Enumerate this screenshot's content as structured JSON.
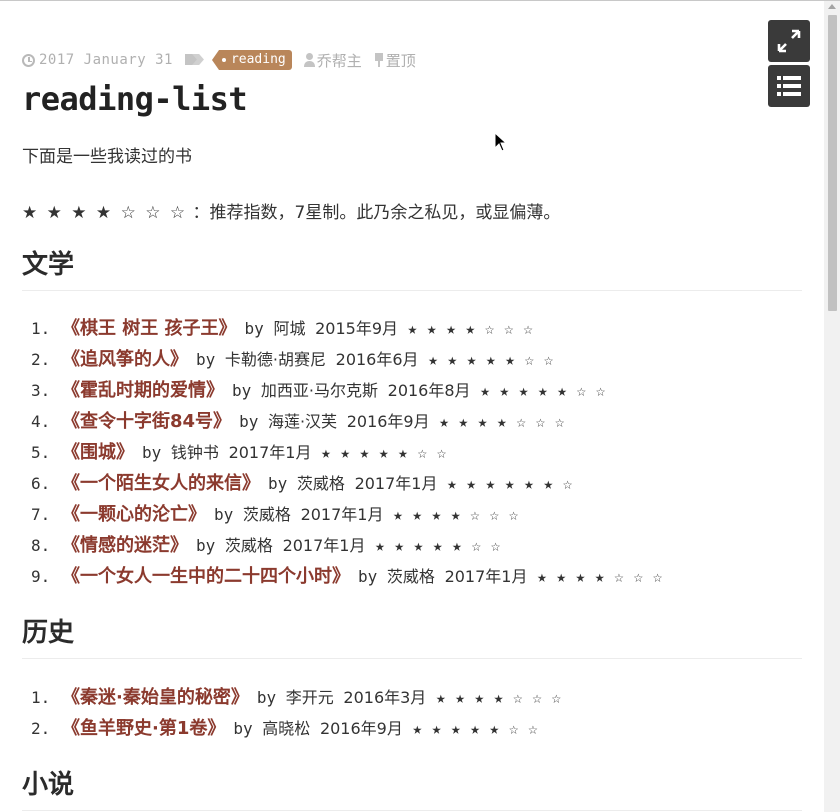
{
  "meta": {
    "date": "2017 January 31",
    "tag": "reading",
    "author": "乔帮主",
    "pin": "置顶"
  },
  "post": {
    "title": "reading-list",
    "intro": "下面是一些我读过的书",
    "rating_stars": "★ ★ ★ ★ ☆ ☆ ☆",
    "rating_note": "：推荐指数，7星制。此乃余之私见，或显偏薄。"
  },
  "sections": [
    {
      "heading": "文学",
      "books": [
        {
          "num": "1.",
          "title": "《棋王 树王 孩子王》",
          "by": "by",
          "author": "阿城",
          "date": "2015年9月",
          "stars": "★ ★ ★ ★ ☆ ☆ ☆"
        },
        {
          "num": "2.",
          "title": "《追风筝的人》",
          "by": "by",
          "author": "卡勒德·胡赛尼",
          "date": "2016年6月",
          "stars": "★ ★ ★ ★ ★ ☆ ☆"
        },
        {
          "num": "3.",
          "title": "《霍乱时期的爱情》",
          "by": "by",
          "author": "加西亚·马尔克斯",
          "date": "2016年8月",
          "stars": "★ ★ ★ ★ ★ ☆ ☆"
        },
        {
          "num": "4.",
          "title": "《查令十字街84号》",
          "by": "by",
          "author": "海莲·汉芙",
          "date": "2016年9月",
          "stars": "★ ★ ★ ★ ☆ ☆ ☆"
        },
        {
          "num": "5.",
          "title": "《围城》",
          "by": "by",
          "author": "钱钟书",
          "date": "2017年1月",
          "stars": "★ ★ ★ ★ ★ ☆ ☆"
        },
        {
          "num": "6.",
          "title": "《一个陌生女人的来信》",
          "by": "by",
          "author": "茨威格",
          "date": "2017年1月",
          "stars": "★ ★ ★ ★ ★ ★ ☆"
        },
        {
          "num": "7.",
          "title": "《一颗心的沦亡》",
          "by": "by",
          "author": "茨威格",
          "date": "2017年1月",
          "stars": "★ ★ ★ ★ ☆ ☆ ☆"
        },
        {
          "num": "8.",
          "title": "《情感的迷茫》",
          "by": "by",
          "author": "茨威格",
          "date": "2017年1月",
          "stars": "★ ★ ★ ★ ★ ☆ ☆"
        },
        {
          "num": "9.",
          "title": "《一个女人一生中的二十四个小时》",
          "by": "by",
          "author": "茨威格",
          "date": "2017年1月",
          "stars": "★ ★ ★ ★ ☆ ☆ ☆"
        }
      ]
    },
    {
      "heading": "历史",
      "books": [
        {
          "num": "1.",
          "title": "《秦迷·秦始皇的秘密》",
          "by": "by",
          "author": "李开元",
          "date": "2016年3月",
          "stars": "★ ★ ★ ★ ☆ ☆ ☆"
        },
        {
          "num": "2.",
          "title": "《鱼羊野史·第1卷》",
          "by": "by",
          "author": "高晓松",
          "date": "2016年9月",
          "stars": "★ ★ ★ ★ ★ ☆ ☆"
        }
      ]
    },
    {
      "heading": "小说",
      "books": []
    }
  ],
  "tools": {
    "expand_icon": "expand-icon",
    "toc_icon": "list-icon"
  },
  "colors": {
    "tag_bg": "#b9865a",
    "link": "#8b3a2e",
    "tool_bg": "#3a3a3a"
  }
}
